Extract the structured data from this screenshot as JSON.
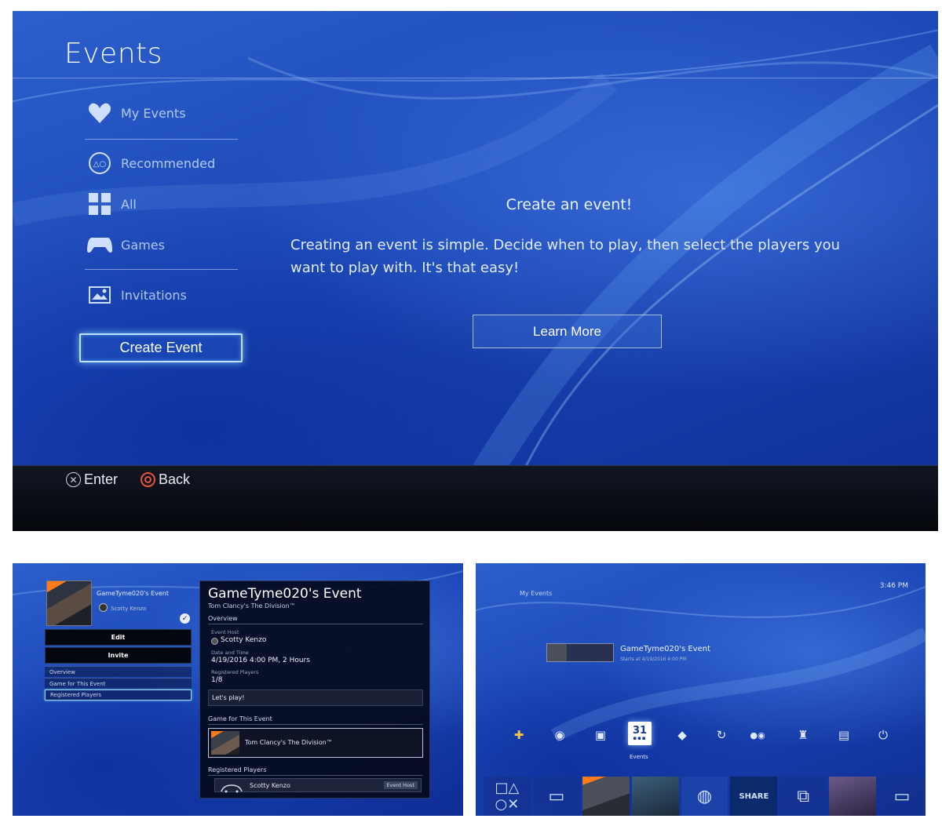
{
  "top": {
    "title": "Events",
    "nav": [
      {
        "label": "My Events",
        "icon": "heart-icon"
      },
      {
        "label": "Recommended",
        "icon": "ps-shapes-icon"
      },
      {
        "label": "All",
        "icon": "grid-icon"
      },
      {
        "label": "Games",
        "icon": "controller-icon"
      },
      {
        "label": "Invitations",
        "icon": "invitation-icon"
      }
    ],
    "create_button": "Create Event",
    "create_title": "Create an event!",
    "create_body": "Creating an event is simple. Decide when to play, then select the players you want to play with. It's that easy!",
    "learn_more": "Learn More",
    "hints": {
      "enter": "Enter",
      "back": "Back"
    }
  },
  "detail_panel": {
    "event_name": "GameTyme020's Event",
    "host_name": "Scotty Kenzo",
    "buttons": {
      "edit": "Edit",
      "invite": "Invite"
    },
    "tabs": [
      "Overview",
      "Game for This Event",
      "Registered Players"
    ],
    "title": "GameTyme020's Event",
    "game_subtitle": "Tom Clancy's The Division™",
    "overview_label": "Overview",
    "host_key": "Event Host",
    "host_value": "Scotty Kenzo",
    "datetime_key": "Date and Time",
    "datetime_value": "4/19/2016  4:00 PM,   2 Hours",
    "registered_key": "Registered Players",
    "registered_value": "1/8",
    "message": "Let's play!",
    "game_section": "Game for This Event",
    "game_name": "Tom Clancy's The Division™",
    "players_section": "Registered Players",
    "player_name": "Scotty Kenzo",
    "player_badge": "Event Host"
  },
  "home_panel": {
    "time": "3:46 PM",
    "section_label": "My Events",
    "event_name": "GameTyme020's Event",
    "event_start": "Starts at  4/19/2016  4:00 PM",
    "calendar_day": "31",
    "function_label": "Events"
  }
}
